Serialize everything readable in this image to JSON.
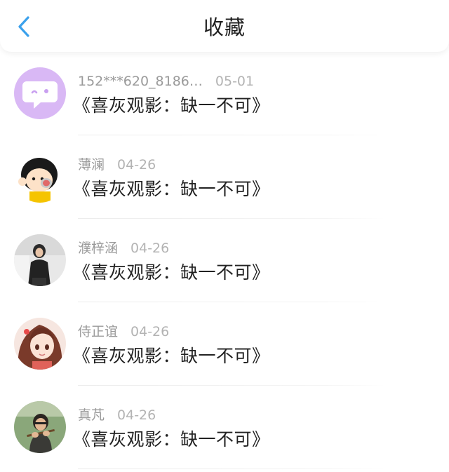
{
  "header": {
    "title": "收藏",
    "back_icon": "chevron-left-icon",
    "accent": "#3ba1ec"
  },
  "items": [
    {
      "user": "152***620_8186…",
      "date": "05-01",
      "title": "《喜灰观影：缺一不可》",
      "avatar": "purple-chat-bubble-icon"
    },
    {
      "user": "薄澜",
      "date": "04-26",
      "title": "《喜灰观影：缺一不可》",
      "avatar": "cartoon-girl-avatar"
    },
    {
      "user": "濮梓涵",
      "date": "04-26",
      "title": "《喜灰观影：缺一不可》",
      "avatar": "photo-girl-avatar"
    },
    {
      "user": "侍正谊",
      "date": "04-26",
      "title": "《喜灰观影：缺一不可》",
      "avatar": "anime-girl-avatar"
    },
    {
      "user": "真芃",
      "date": "04-26",
      "title": "《喜灰观影：缺一不可》",
      "avatar": "photo-person-avatar"
    }
  ]
}
